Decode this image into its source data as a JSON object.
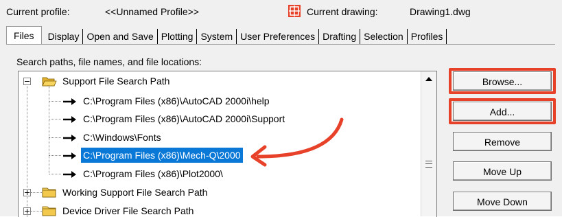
{
  "header": {
    "current_profile_label": "Current profile:",
    "current_profile_value": "<<Unnamed Profile>>",
    "current_drawing_label": "Current drawing:",
    "current_drawing_value": "Drawing1.dwg"
  },
  "tabs": [
    {
      "label": "Files",
      "active": true
    },
    {
      "label": "Display"
    },
    {
      "label": "Open and Save"
    },
    {
      "label": "Plotting"
    },
    {
      "label": "System"
    },
    {
      "label": "User Preferences"
    },
    {
      "label": "Drafting"
    },
    {
      "label": "Selection"
    },
    {
      "label": "Profiles"
    }
  ],
  "caption": "Search paths, file names, and file locations:",
  "tree": {
    "root": {
      "label": "Support File Search Path",
      "expanded": true
    },
    "children": [
      "C:\\Program Files (x86)\\AutoCAD 2000i\\help",
      "C:\\Program Files (x86)\\AutoCAD 2000i\\Support",
      "C:\\Windows\\Fonts",
      "C:\\Program Files (x86)\\Mech-Q\\2000",
      "C:\\Program Files (x86)\\Plot2000\\"
    ],
    "selected_index": 3,
    "collapsed": [
      "Working Support File Search Path",
      "Device Driver File Search Path"
    ]
  },
  "buttons": {
    "browse": "Browse...",
    "add": "Add...",
    "remove": "Remove",
    "move_up": "Move Up",
    "move_down": "Move Down"
  },
  "annotation_color": "#e8412a",
  "selection_color": "#0a78d7"
}
